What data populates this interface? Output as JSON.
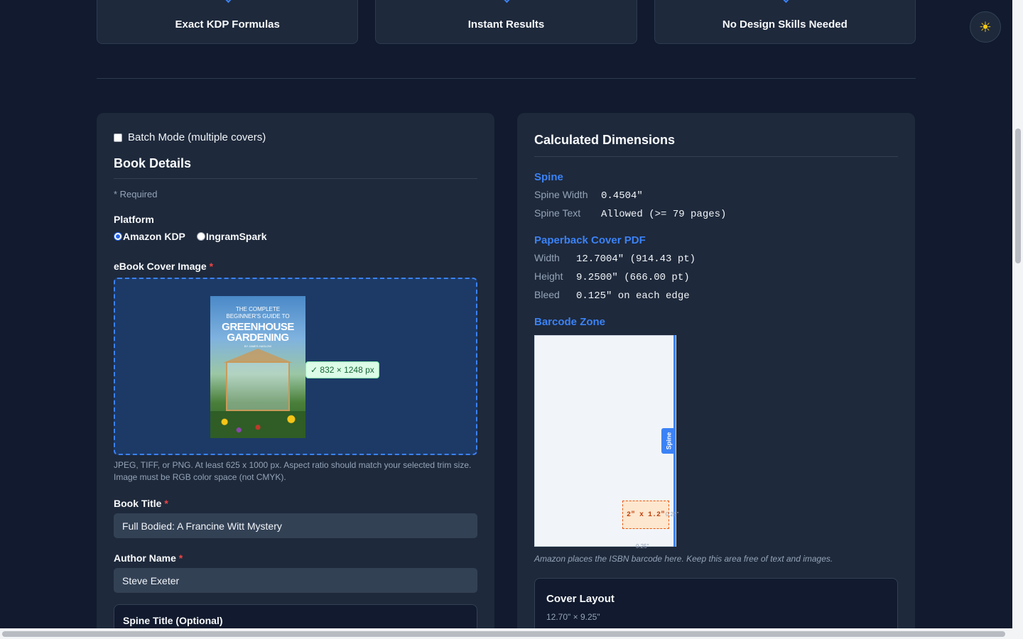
{
  "features": [
    "Exact KDP Formulas",
    "Instant Results",
    "No Design Skills Needed"
  ],
  "theme_toggle_icon": "☀",
  "left": {
    "batch_label": "Batch Mode (multiple covers)",
    "section_title": "Book Details",
    "required_note": "* Required",
    "platform_label": "Platform",
    "platforms": [
      {
        "label": "Amazon KDP",
        "selected": true
      },
      {
        "label": "IngramSpark",
        "selected": false
      }
    ],
    "cover_label": "eBook Cover Image",
    "cover_thumb": {
      "line1": "THE COMPLETE",
      "line2": "BEGINNER'S GUIDE TO",
      "title1": "GREENHOUSE",
      "title2": "GARDENING",
      "byline": "BY JAMES HASLOW"
    },
    "image_size_badge": "✓ 832 × 1248 px",
    "cover_help": "JPEG, TIFF, or PNG. At least 625 x 1000 px. Aspect ratio should match your selected trim size. Image must be RGB color space (not CMYK).",
    "book_title_label": "Book Title",
    "book_title_value": "Full Bodied: A Francine Witt Mystery",
    "author_label": "Author Name",
    "author_value": "Steve Exeter",
    "spine_title_label": "Spine Title (Optional)"
  },
  "right": {
    "title": "Calculated Dimensions",
    "spine_heading": "Spine",
    "spine_width_label": "Spine Width",
    "spine_width_value": "0.4504\"",
    "spine_text_label": "Spine Text",
    "spine_text_value": "Allowed (>= 79 pages)",
    "pdf_heading": "Paperback Cover PDF",
    "width_label": "Width",
    "width_value": "12.7004\" (914.43 pt)",
    "height_label": "Height",
    "height_value": "9.2500\" (666.00 pt)",
    "bleed_label": "Bleed",
    "bleed_value": "0.125\" on each edge",
    "barcode_heading": "Barcode Zone",
    "spine_tag": "Spine",
    "barcode_size": "2\" x 1.2\"",
    "barcode_right_margin": "0.25\"",
    "barcode_bottom_margin": "0.25\"",
    "barcode_note": "Amazon places the ISBN barcode here. Keep this area free of text and images.",
    "layout_heading": "Cover Layout",
    "layout_sub": "12.70\" × 9.25\""
  }
}
